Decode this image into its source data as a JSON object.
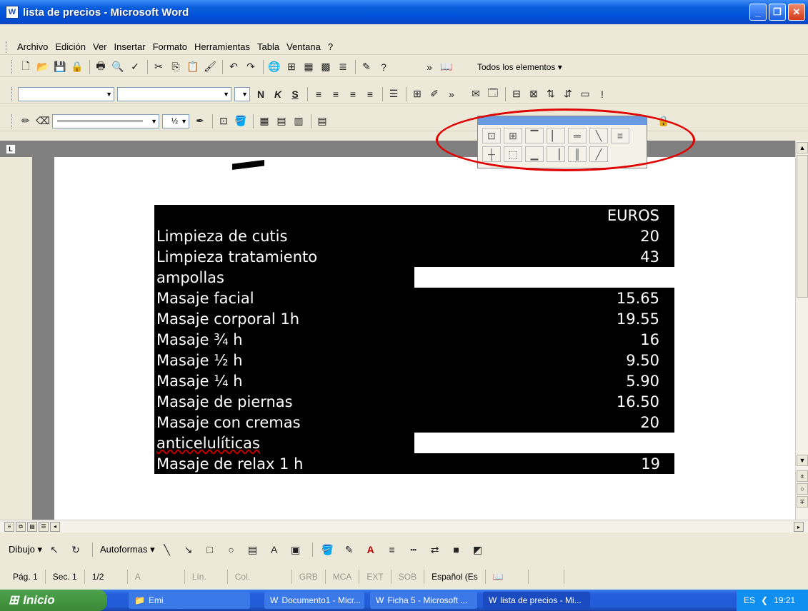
{
  "window": {
    "title": "lista de precios - Microsoft Word",
    "icon": "word-icon"
  },
  "menu": {
    "items": [
      "Archivo",
      "Edición",
      "Ver",
      "Insertar",
      "Formato",
      "Herramientas",
      "Tabla",
      "Ventana",
      "?"
    ]
  },
  "toolbar": {
    "all_elements": "Todos los elementos ▾"
  },
  "format": {
    "font_size_fraction": "½"
  },
  "table": {
    "header_right": "EUROS",
    "rows": [
      {
        "label": "Limpieza de cutis",
        "price": "20"
      },
      {
        "label": "Limpieza tratamiento",
        "price": "43"
      },
      {
        "label": "ampollas",
        "price": ""
      },
      {
        "label": "Masaje facial",
        "price": "15.65"
      },
      {
        "label": "Masaje corporal  1h",
        "price": "19.55"
      },
      {
        "label": "Masaje ¾ h",
        "price": "16"
      },
      {
        "label": "Masaje ½ h",
        "price": "9.50"
      },
      {
        "label": "Masaje ¼ h",
        "price": "5.90"
      },
      {
        "label": "Masaje de piernas",
        "price": "16.50"
      },
      {
        "label": "Masaje con cremas",
        "price": "20"
      },
      {
        "label": "anticelulíticas",
        "price": ""
      },
      {
        "label": "Masaje de relax 1 h",
        "price": "19"
      }
    ]
  },
  "drawing": {
    "dibujo": "Dibujo ▾",
    "autoformas": "Autoformas ▾"
  },
  "status": {
    "page": "Pág. 1",
    "section": "Sec. 1",
    "pages": "1/2",
    "a": "A",
    "lin": "Lín.",
    "col": "Col.",
    "grb": "GRB",
    "mca": "MCA",
    "ext": "EXT",
    "sob": "SOB",
    "lang": "Español (Es"
  },
  "taskbar": {
    "start": "Inicio",
    "tasks": [
      "Emi",
      "Documento1 - Micr...",
      "Ficha 5 - Microsoft ...",
      "lista de precios - Mi..."
    ],
    "lang": "ES",
    "time": "19:21"
  },
  "colors": {
    "titlebar": "#0050d8",
    "annotation": "#e00000",
    "table_bg": "#000000"
  }
}
